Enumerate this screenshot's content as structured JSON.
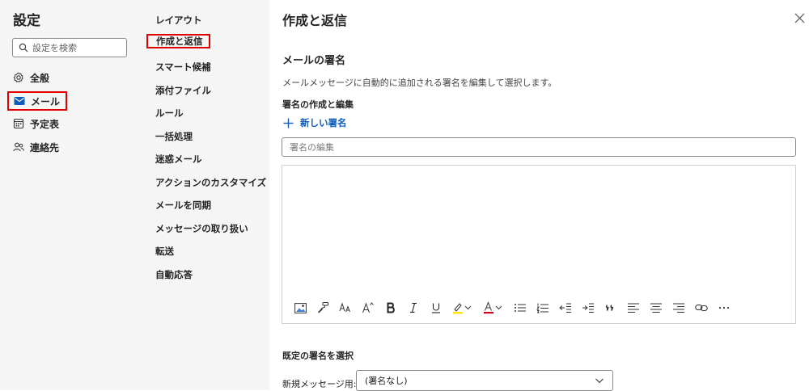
{
  "sidebar": {
    "title": "設定",
    "search_placeholder": "設定を検索",
    "items": [
      {
        "label": "全般",
        "icon": "gear-icon"
      },
      {
        "label": "メール",
        "icon": "mail-icon"
      },
      {
        "label": "予定表",
        "icon": "calendar-icon"
      },
      {
        "label": "連絡先",
        "icon": "people-icon"
      }
    ]
  },
  "subnav": {
    "items": [
      {
        "label": "レイアウト"
      },
      {
        "label": "作成と返信"
      },
      {
        "label": "スマート候補"
      },
      {
        "label": "添付ファイル"
      },
      {
        "label": "ルール"
      },
      {
        "label": "一括処理"
      },
      {
        "label": "迷惑メール"
      },
      {
        "label": "アクションのカスタマイズ"
      },
      {
        "label": "メールを同期"
      },
      {
        "label": "メッセージの取り扱い"
      },
      {
        "label": "転送"
      },
      {
        "label": "自動応答"
      }
    ]
  },
  "panel": {
    "title": "作成と返信",
    "section_title": "メールの署名",
    "section_desc": "メールメッセージに自動的に追加される署名を編集して選択します。",
    "subsection_title": "署名の作成と編集",
    "new_signature_label": "新しい署名",
    "signature_name_placeholder": "署名の編集",
    "default_section_title": "既定の署名を選択",
    "new_message_label": "新規メッセージ用:",
    "new_message_value": "(署名なし)"
  },
  "colors": {
    "accent": "#0f5db8",
    "highlight_box": "#e00000",
    "sidebar_bg": "#f5f5f5"
  }
}
